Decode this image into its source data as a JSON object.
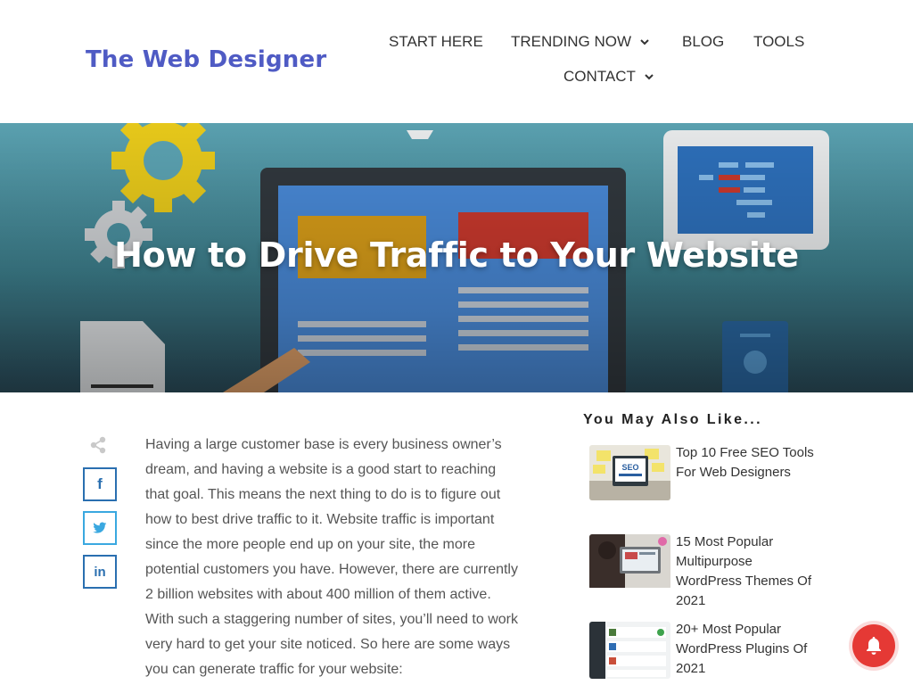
{
  "site": {
    "logo": "The Web Designer"
  },
  "nav": {
    "start_here": "START HERE",
    "trending_now": "TRENDING NOW",
    "blog": "BLOG",
    "tools": "TOOLS",
    "contact": "CONTACT"
  },
  "hero": {
    "title": "How to Drive Traffic to Your Website"
  },
  "share": {
    "facebook_glyph": "f",
    "linkedin_glyph": "in",
    "icons": [
      "share-icon",
      "facebook-icon",
      "twitter-icon",
      "linkedin-icon"
    ]
  },
  "article": {
    "intro": "Having a large customer base is every business owner’s dream, and having a website is a good start to reaching that goal. This means the next thing to do is to figure out how to best drive traffic to it. Website traffic is important since the more people end up on your site, the more potential customers you have. However, there are currently 2 billion websites with about 400 million of them active. With such a staggering number of sites, you’ll need to work very hard to get your site noticed. So here are some ways you can generate traffic for your website:"
  },
  "sidebar": {
    "title": "You May Also Like...",
    "posts": [
      {
        "title": "Top 10 Free SEO Tools For Web Designers"
      },
      {
        "title": "15 Most Popular Multipurpose WordPress Themes Of 2021"
      },
      {
        "title": "20+ Most Popular WordPress Plugins Of 2021"
      }
    ]
  },
  "colors": {
    "brand": "#4f5bc4",
    "facebook": "#2a6fb0",
    "twitter": "#3aa8e0",
    "notification": "#e53935"
  }
}
